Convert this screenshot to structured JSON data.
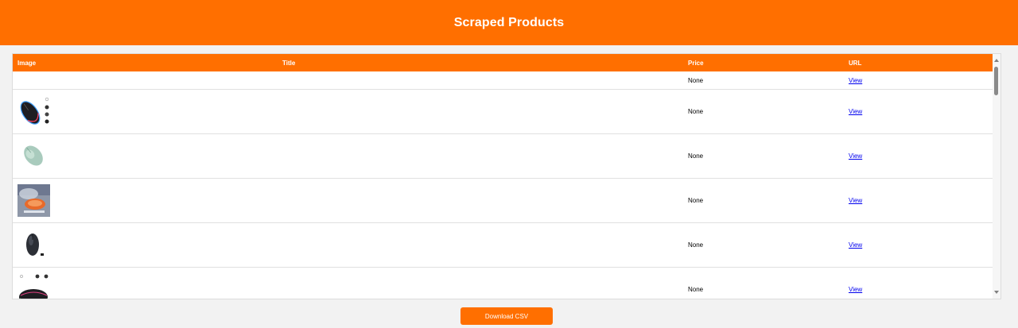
{
  "header": {
    "title": "Scraped Products"
  },
  "table": {
    "columns": [
      "Image",
      "Title",
      "Price",
      "URL"
    ],
    "rows": [
      {
        "image": "none",
        "title": "",
        "price": "None",
        "url_label": "View"
      },
      {
        "image": "rgb-mouse-with-buttons",
        "title": "",
        "price": "None",
        "url_label": "View"
      },
      {
        "image": "mint-green-mouse",
        "title": "",
        "price": "None",
        "url_label": "View"
      },
      {
        "image": "transparent-mouse-photo",
        "title": "",
        "price": "None",
        "url_label": "View"
      },
      {
        "image": "black-slim-mouse",
        "title": "",
        "price": "None",
        "url_label": "View"
      },
      {
        "image": "rgb-mouse-partial",
        "title": "",
        "price": "None",
        "url_label": "View"
      }
    ]
  },
  "footer": {
    "download_label": "Download CSV"
  },
  "colors": {
    "accent": "#ff6f00",
    "link": "#0000ee",
    "background": "#f2f2f2"
  }
}
